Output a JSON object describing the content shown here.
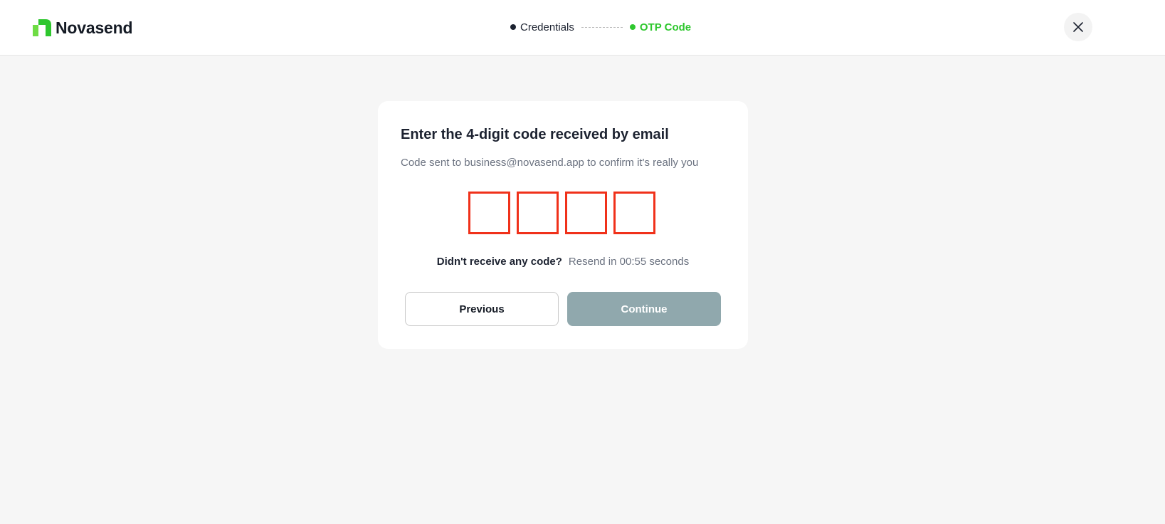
{
  "brand": {
    "name": "Novasend",
    "accent_color": "#2ec72e"
  },
  "steps": [
    {
      "label": "Credentials",
      "state": "completed"
    },
    {
      "label": "OTP Code",
      "state": "active"
    }
  ],
  "close": {
    "icon": "close-icon"
  },
  "otp_card": {
    "title": "Enter the 4-digit code received by email",
    "subtitle": "Code sent to business@novasend.app to confirm it's really you",
    "digits": [
      "",
      "",
      "",
      ""
    ],
    "error_color": "#f0311a",
    "resend_question": "Didn't receive any code?",
    "resend_timer": "Resend in 00:55 seconds",
    "previous_label": "Previous",
    "continue_label": "Continue"
  }
}
